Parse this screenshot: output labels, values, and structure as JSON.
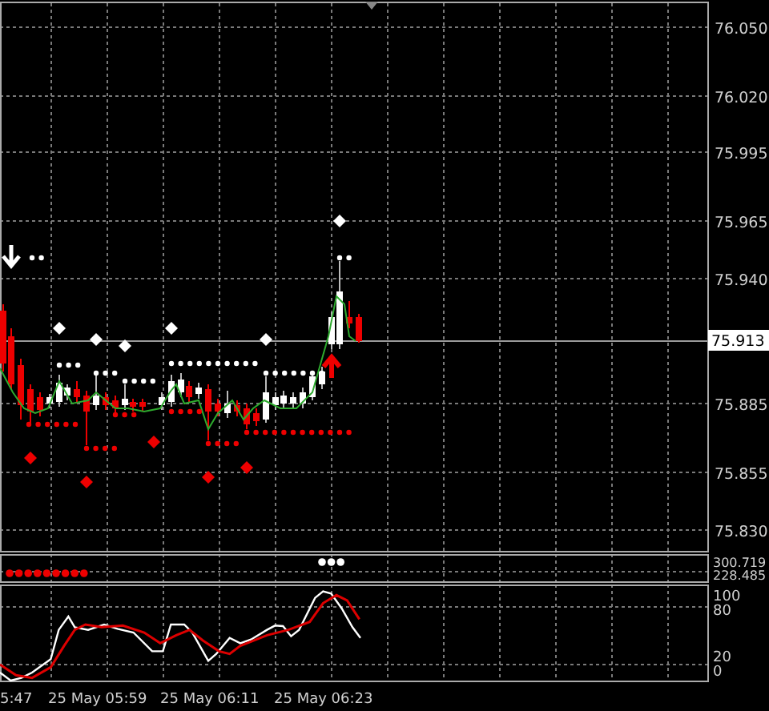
{
  "price_axis": {
    "labels": [
      "76.050",
      "76.020",
      "75.995",
      "75.965",
      "75.940",
      "75.885",
      "75.855",
      "75.830"
    ]
  },
  "current_price": "75.913",
  "indicator_1": {
    "axis_labels": [
      "300.719",
      "228.485"
    ]
  },
  "indicator_2": {
    "axis_labels": [
      "100",
      "80",
      "20",
      "0"
    ]
  },
  "time_axis": {
    "labels": [
      "5:47",
      "25 May 05:59",
      "25 May 06:11",
      "25 May 06:23"
    ]
  }
}
